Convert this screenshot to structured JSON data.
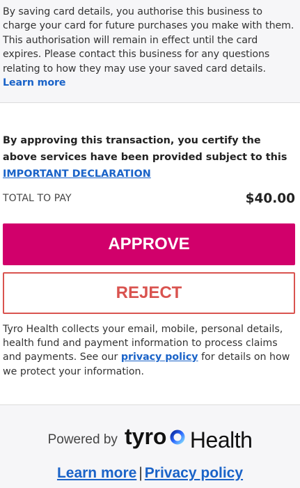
{
  "consent": {
    "text": "By saving card details, you authorise this business to charge your card for future purchases you make with them. This authorisation will remain in effect until the card expires. Please contact this business for any questions relating to how they may use your saved card details.",
    "learn_more": "Learn more"
  },
  "declaration": {
    "text": "By approving this transaction, you certify the above services have been provided subject to this",
    "link": "IMPORTANT DECLARATION"
  },
  "total": {
    "label": "TOTAL TO PAY",
    "amount": "$40.00"
  },
  "actions": {
    "approve": "APPROVE",
    "reject": "REJECT"
  },
  "privacy": {
    "text_before": "Tyro Health collects your email, mobile, personal details, health fund and payment information to process claims and payments. See our",
    "link": "privacy policy",
    "text_after": "for details on how we protect your information."
  },
  "footer": {
    "powered_by": "Powered by",
    "brand_word": "tyro",
    "brand_suffix": "Health",
    "learn_more": "Learn more",
    "separator": "|",
    "privacy_policy": "Privacy policy"
  },
  "colors": {
    "approve_bg": "#d1006b",
    "reject": "#d9534f",
    "link": "#1a63c8"
  }
}
